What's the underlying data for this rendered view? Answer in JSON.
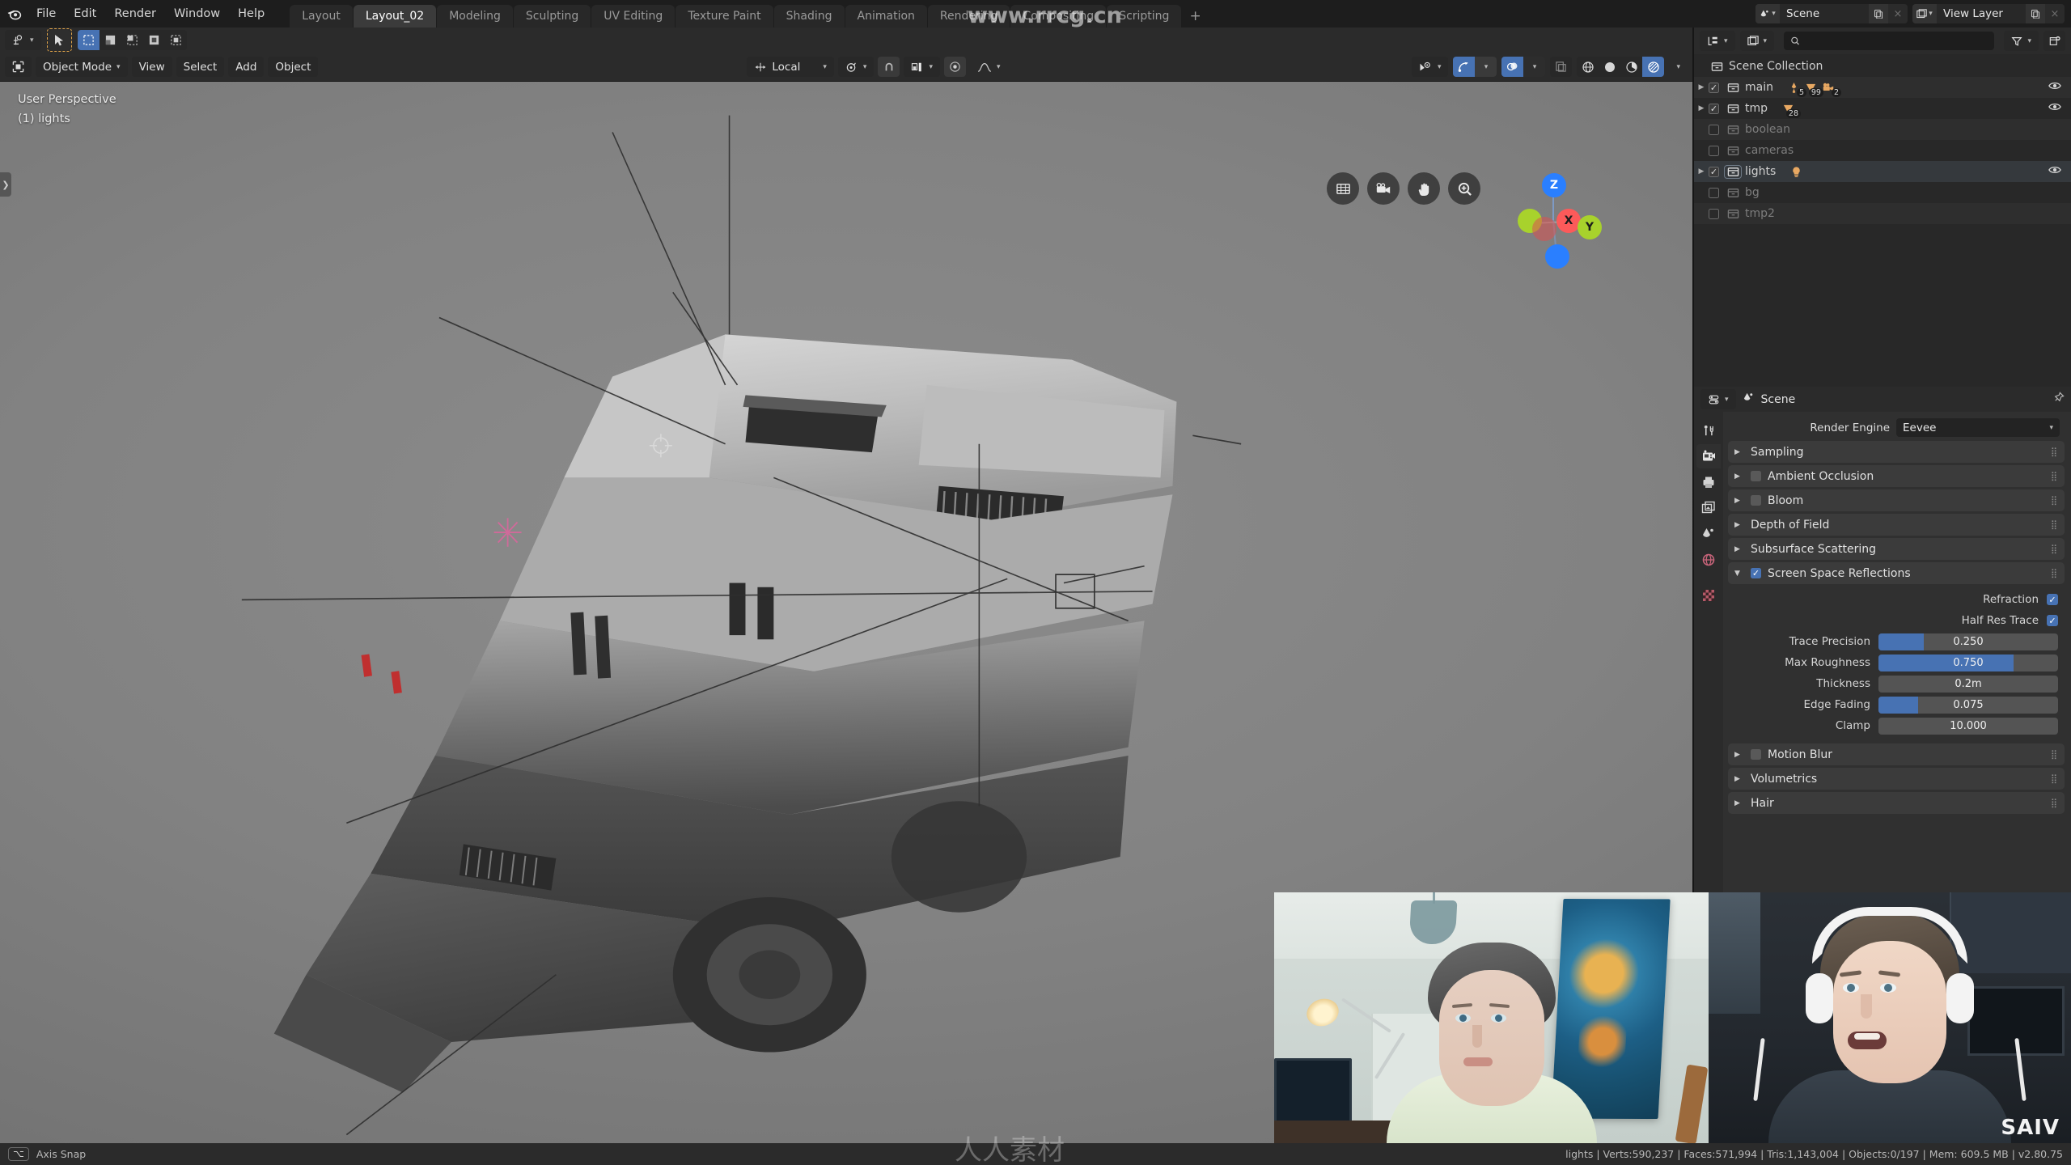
{
  "app": {
    "menus": [
      "File",
      "Edit",
      "Render",
      "Window",
      "Help"
    ],
    "workspace_tabs": [
      {
        "label": "Layout",
        "active": false
      },
      {
        "label": "Layout_02",
        "active": true
      },
      {
        "label": "Modeling",
        "active": false
      },
      {
        "label": "Sculpting",
        "active": false
      },
      {
        "label": "UV Editing",
        "active": false
      },
      {
        "label": "Texture Paint",
        "active": false
      },
      {
        "label": "Shading",
        "active": false
      },
      {
        "label": "Animation",
        "active": false
      },
      {
        "label": "Rendering",
        "active": false
      },
      {
        "label": "Compositing",
        "active": false
      },
      {
        "label": "Scripting",
        "active": false
      }
    ],
    "add_workspace": "+",
    "scene": {
      "name": "Scene",
      "new_label": "",
      "delete_label": "×"
    },
    "view_layer": {
      "name": "View Layer",
      "new_label": "",
      "delete_label": "×"
    },
    "watermark_url": "www.rrcg.cn"
  },
  "viewport_header": {
    "mode": "Object Mode",
    "menus": [
      "View",
      "Select",
      "Add",
      "Object"
    ],
    "transform_orientation": "Local",
    "snap_enabled": false,
    "proportional_edit": false
  },
  "viewport": {
    "perspective_label": "User Perspective",
    "active_collection_label": "(1) lights",
    "gizmo_axes": [
      {
        "label": "X",
        "color": "#fc5a5a"
      },
      {
        "label": "Y",
        "color": "#a8d22c"
      },
      {
        "label": "Z",
        "color": "#2a7fff"
      }
    ],
    "nav_buttons": [
      "grid-zoom-icon",
      "camera-view-icon",
      "pan-hand-icon",
      "zoom-magnifier-icon"
    ],
    "shading_modes": [
      "wireframe",
      "solid",
      "material-preview",
      "rendered"
    ],
    "active_shading_mode": "rendered"
  },
  "outliner": {
    "display_mode": "View Layer",
    "search_placeholder": "",
    "root": "Scene Collection",
    "items": [
      {
        "name": "main",
        "checked": true,
        "expandable": true,
        "dim": false,
        "eye": true,
        "badges": [
          {
            "icon": "armature-icon",
            "count": "5"
          },
          {
            "icon": "mesh-icon",
            "count": "99"
          },
          {
            "icon": "camera-icon",
            "count": "2"
          }
        ]
      },
      {
        "name": "tmp",
        "checked": true,
        "expandable": true,
        "dim": false,
        "eye": true,
        "badges": [
          {
            "icon": "mesh-icon",
            "count": "28"
          }
        ]
      },
      {
        "name": "boolean",
        "checked": false,
        "expandable": false,
        "dim": true,
        "eye": false,
        "badges": []
      },
      {
        "name": "cameras",
        "checked": false,
        "expandable": false,
        "dim": true,
        "eye": false,
        "badges": []
      },
      {
        "name": "lights",
        "checked": true,
        "expandable": true,
        "dim": false,
        "eye": true,
        "selected": true,
        "badges": [
          {
            "icon": "light-icon",
            "count": ""
          }
        ]
      },
      {
        "name": "bg",
        "checked": false,
        "expandable": false,
        "dim": true,
        "eye": false,
        "badges": []
      },
      {
        "name": "tmp2",
        "checked": false,
        "expandable": false,
        "dim": true,
        "eye": false,
        "badges": []
      }
    ]
  },
  "properties": {
    "breadcrumb": "Scene",
    "tabs": [
      "tool-icon",
      "render-icon",
      "output-icon",
      "view-layer-icon",
      "scene-icon",
      "world-icon",
      "texture-icon"
    ],
    "active_tab_index": 1,
    "render_engine_label": "Render Engine",
    "render_engine_value": "Eevee",
    "panels": [
      {
        "title": "Sampling",
        "open": false,
        "has_checkbox": false,
        "checked": false
      },
      {
        "title": "Ambient Occlusion",
        "open": false,
        "has_checkbox": true,
        "checked": false
      },
      {
        "title": "Bloom",
        "open": false,
        "has_checkbox": true,
        "checked": false
      },
      {
        "title": "Depth of Field",
        "open": false,
        "has_checkbox": false,
        "checked": false
      },
      {
        "title": "Subsurface Scattering",
        "open": false,
        "has_checkbox": false,
        "checked": false
      },
      {
        "title": "Screen Space Reflections",
        "open": true,
        "has_checkbox": true,
        "checked": true
      }
    ],
    "ssr": {
      "checkboxes": [
        {
          "label": "Refraction",
          "checked": true
        },
        {
          "label": "Half Res Trace",
          "checked": true
        }
      ],
      "sliders": [
        {
          "label": "Trace Precision",
          "value": "0.250",
          "fill": 0.25
        },
        {
          "label": "Max Roughness",
          "value": "0.750",
          "fill": 0.75
        },
        {
          "label": "Thickness",
          "value": "0.2m",
          "fill": 0
        },
        {
          "label": "Edge Fading",
          "value": "0.075",
          "fill": 0.22
        },
        {
          "label": "Clamp",
          "value": "10.000",
          "fill": 0
        }
      ]
    },
    "trailing_panels": [
      {
        "title": "Motion Blur",
        "open": false,
        "has_checkbox": true,
        "checked": false
      },
      {
        "title": "Volumetrics",
        "open": false,
        "has_checkbox": false,
        "checked": false
      },
      {
        "title": "Hair",
        "open": false,
        "has_checkbox": false,
        "checked": false
      }
    ]
  },
  "statusbar": {
    "keymap_key": "⌥",
    "keymap_action": "Axis Snap",
    "stats": "lights | Verts:590,237 | Faces:571,994 | Tris:1,143,004 | Objects:0/197 | Mem: 609.5 MB | v2.80.75"
  },
  "overlay_cams": {
    "cam1_name": "webcam-left",
    "cam2_name": "webcam-right",
    "cam2_logo": "SAIV"
  },
  "colors": {
    "accent_blue": "#4772b3",
    "panel_bg": "#303030",
    "header_bg": "#2b2b2b",
    "outliner_bg": "#282828",
    "collection_orange": "#e8a862",
    "axis_x": "#fc5a5a",
    "axis_y": "#a8d22c",
    "axis_z": "#2a7fff"
  }
}
